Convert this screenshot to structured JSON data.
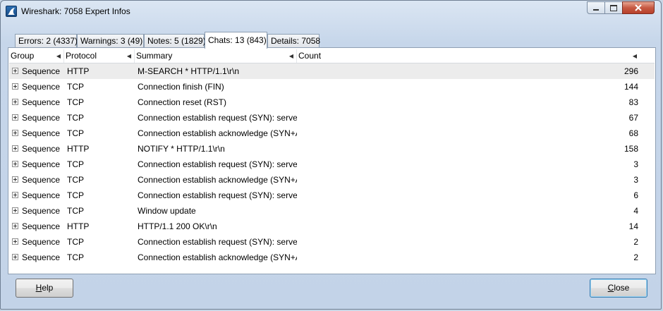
{
  "window": {
    "title": "Wireshark: 7058 Expert Infos"
  },
  "tabs": [
    {
      "label": "Errors: 2 (4337)",
      "active": false
    },
    {
      "label": "Warnings: 3 (49)",
      "active": false
    },
    {
      "label": "Notes: 5 (1829)",
      "active": false
    },
    {
      "label": "Chats: 13 (843)",
      "active": true
    },
    {
      "label": "Details: 7058",
      "active": false
    }
  ],
  "columns": {
    "group": "Group",
    "protocol": "Protocol",
    "summary": "Summary",
    "count": "Count"
  },
  "rows": [
    {
      "group": "Sequence",
      "protocol": "HTTP",
      "summary": "M-SEARCH * HTTP/1.1\\r\\n",
      "count": "296"
    },
    {
      "group": "Sequence",
      "protocol": "TCP",
      "summary": "Connection finish (FIN)",
      "count": "144"
    },
    {
      "group": "Sequence",
      "protocol": "TCP",
      "summary": "Connection reset (RST)",
      "count": "83"
    },
    {
      "group": "Sequence",
      "protocol": "TCP",
      "summary": "Connection establish request (SYN): server",
      "count": "67"
    },
    {
      "group": "Sequence",
      "protocol": "TCP",
      "summary": "Connection establish acknowledge (SYN+A",
      "count": "68"
    },
    {
      "group": "Sequence",
      "protocol": "HTTP",
      "summary": "NOTIFY * HTTP/1.1\\r\\n",
      "count": "158"
    },
    {
      "group": "Sequence",
      "protocol": "TCP",
      "summary": "Connection establish request (SYN): server",
      "count": "3"
    },
    {
      "group": "Sequence",
      "protocol": "TCP",
      "summary": "Connection establish acknowledge (SYN+A",
      "count": "3"
    },
    {
      "group": "Sequence",
      "protocol": "TCP",
      "summary": "Connection establish request (SYN): server",
      "count": "6"
    },
    {
      "group": "Sequence",
      "protocol": "TCP",
      "summary": "Window update",
      "count": "4"
    },
    {
      "group": "Sequence",
      "protocol": "HTTP",
      "summary": "HTTP/1.1 200 OK\\r\\n",
      "count": "14"
    },
    {
      "group": "Sequence",
      "protocol": "TCP",
      "summary": "Connection establish request (SYN): server",
      "count": "2"
    },
    {
      "group": "Sequence",
      "protocol": "TCP",
      "summary": "Connection establish acknowledge (SYN+A",
      "count": "2"
    }
  ],
  "buttons": {
    "help_mnemonic": "H",
    "help_rest": "elp",
    "close_mnemonic": "C",
    "close_rest": "lose"
  },
  "icons": {
    "app": "wireshark-fin-icon",
    "minimize": "minimize-icon",
    "maximize": "maximize-icon",
    "close": "close-icon",
    "sort": "sort-arrow-icon",
    "expand": "expand-plus-icon"
  }
}
